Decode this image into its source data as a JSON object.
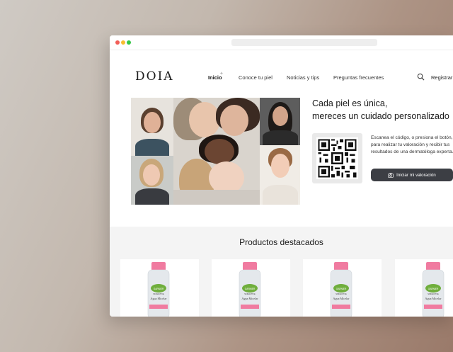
{
  "brand": {
    "logo": "DOIA"
  },
  "nav": {
    "links": [
      "Inicio",
      "Conoce tu piel",
      "Noticias y tips",
      "Preguntas frecuentes"
    ],
    "active": "Inicio",
    "register_label": "Registrar"
  },
  "hero": {
    "title_line1": "Cada piel es única,",
    "title_line2": "mereces un cuidado personalizado",
    "qr_description": "Escanea el código, o presiona el botón, para realizar tu valoración y recibir tus resultados de una dermatóloga experta.",
    "cta_label": "Iniciar mi valoración"
  },
  "products": {
    "title": "Productos destacados",
    "items": [
      {
        "brand": "GARNIER",
        "line": "SKINACTIVE",
        "name": "Agua Micelar"
      },
      {
        "brand": "GARNIER",
        "line": "SKINACTIVE",
        "name": "Agua Micelar"
      },
      {
        "brand": "GARNIER",
        "line": "SKINACTIVE",
        "name": "Agua Micelar"
      },
      {
        "brand": "GARNIER",
        "line": "SKINACTIVE",
        "name": "Agua Micelar"
      }
    ]
  },
  "colors": {
    "accent_pink": "#e8628d",
    "cta_bg": "#3c3e44",
    "products_bg": "#f4f4f4"
  },
  "icons": [
    "search-icon",
    "camera-icon",
    "sparkle-icon",
    "qr-code-icon"
  ]
}
